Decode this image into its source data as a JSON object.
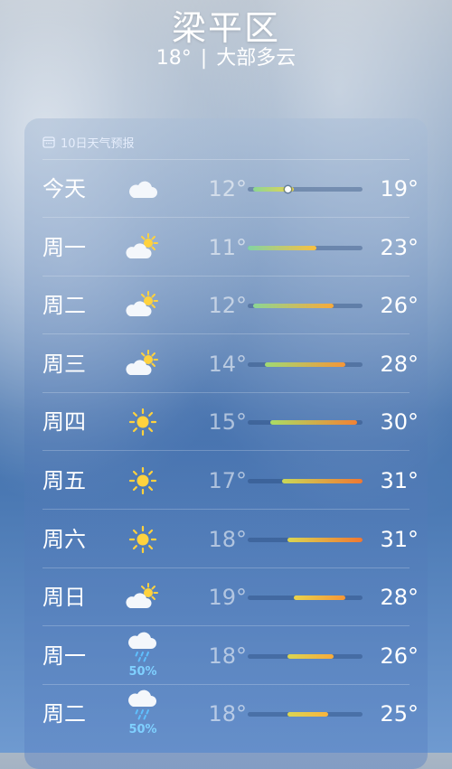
{
  "header": {
    "city": "梁平区",
    "current_temp": "18°",
    "separator": "|",
    "condition": "大部多云"
  },
  "forecast": {
    "title": "10日天气预报",
    "scale": {
      "min": 11,
      "max": 31
    },
    "current": 18,
    "days": [
      {
        "day": "今天",
        "icon": "cloud-icon",
        "low": "12°",
        "high": "19°",
        "low_value": 12,
        "high_value": 19
      },
      {
        "day": "周一",
        "icon": "partly-cloudy-icon",
        "low": "11°",
        "high": "23°",
        "low_value": 11,
        "high_value": 23
      },
      {
        "day": "周二",
        "icon": "partly-cloudy-icon",
        "low": "12°",
        "high": "26°",
        "low_value": 12,
        "high_value": 26
      },
      {
        "day": "周三",
        "icon": "partly-cloudy-icon",
        "low": "14°",
        "high": "28°",
        "low_value": 14,
        "high_value": 28
      },
      {
        "day": "周四",
        "icon": "sun-icon",
        "low": "15°",
        "high": "30°",
        "low_value": 15,
        "high_value": 30
      },
      {
        "day": "周五",
        "icon": "sun-icon",
        "low": "17°",
        "high": "31°",
        "low_value": 17,
        "high_value": 31
      },
      {
        "day": "周六",
        "icon": "sun-icon",
        "low": "18°",
        "high": "31°",
        "low_value": 18,
        "high_value": 31
      },
      {
        "day": "周日",
        "icon": "partly-cloudy-icon",
        "low": "19°",
        "high": "28°",
        "low_value": 19,
        "high_value": 28
      },
      {
        "day": "周一",
        "icon": "rain-icon",
        "precip": "50%",
        "low": "18°",
        "high": "26°",
        "low_value": 18,
        "high_value": 26
      },
      {
        "day": "周二",
        "icon": "rain-icon",
        "precip": "50%",
        "low": "18°",
        "high": "25°",
        "low_value": 18,
        "high_value": 25
      }
    ]
  }
}
